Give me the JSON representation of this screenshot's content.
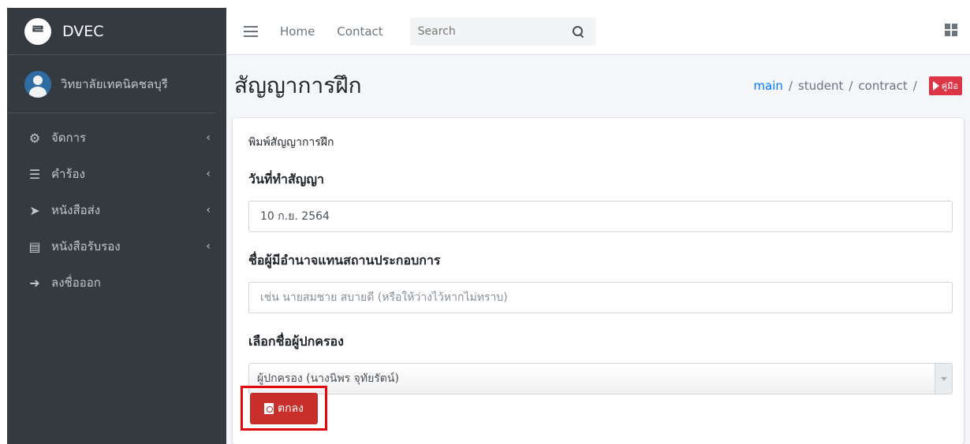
{
  "brand": {
    "logo_glyph": "ᄅ",
    "name": "DVEC"
  },
  "user": {
    "name": "วิทยาลัยเทคนิคชลบุรี"
  },
  "sidebar": {
    "items": [
      {
        "icon": "gears-icon",
        "glyph": "⚙",
        "label": "จัดการ",
        "chevron": "‹"
      },
      {
        "icon": "list-icon",
        "glyph": "☰",
        "label": "คำร้อง",
        "chevron": "‹"
      },
      {
        "icon": "paper-plane-icon",
        "glyph": "➤",
        "label": "หนังสือส่ง",
        "chevron": "‹"
      },
      {
        "icon": "file-icon",
        "glyph": "▤",
        "label": "หนังสือรับรอง",
        "chevron": "‹"
      },
      {
        "icon": "sign-out-icon",
        "glyph": "➜",
        "label": "ลงชื่อออก",
        "chevron": ""
      }
    ]
  },
  "topbar": {
    "home": "Home",
    "contact": "Contact",
    "search_placeholder": "Search"
  },
  "page": {
    "title": "สัญญาการฝึก",
    "breadcrumb": {
      "main": "main",
      "student": "student",
      "contract": "contract",
      "sep": "/",
      "guide": "คู่มือ"
    }
  },
  "card": {
    "header": "พิมพ์สัญญาการฝึก",
    "date_label": "วันที่ทำสัญญา",
    "date_value": "10 ก.ย. 2564",
    "rep_label": "ชื่อผู้มีอำนาจแทนสถานประกอบการ",
    "rep_placeholder": "เช่น นายสมชาย สบายดี (หรือให้ว่างไว้หากไม่ทราบ)",
    "guardian_label": "เลือกชื่อผู้ปกครอง",
    "guardian_selected": "ผู้ปกครอง (นางนิพร จุทัยรัตน์)",
    "submit": "ตกลง"
  },
  "colors": {
    "sidebar_bg": "#343a40",
    "content_bg": "#f4f6f9",
    "link": "#007bff",
    "danger": "#dc3545",
    "highlight_border": "#e4070c"
  }
}
